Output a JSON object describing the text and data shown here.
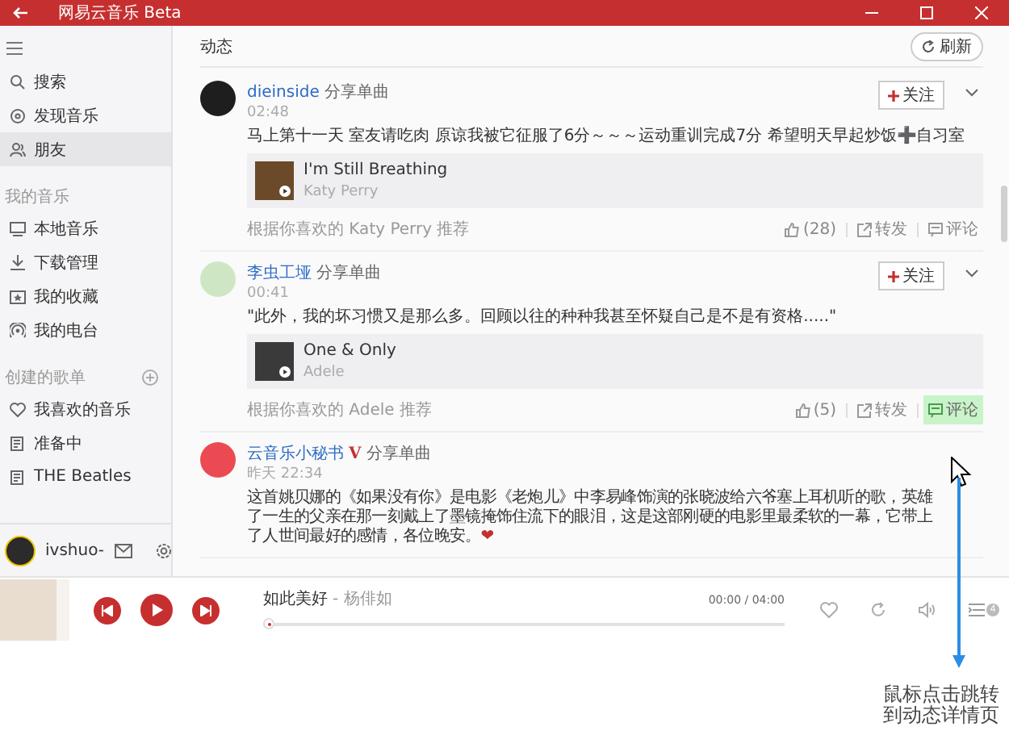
{
  "window": {
    "title": "网易云音乐 Beta"
  },
  "sidebar": {
    "nav": [
      {
        "label": "搜索",
        "selected": false
      },
      {
        "label": "发现音乐",
        "selected": false
      },
      {
        "label": "朋友",
        "selected": true
      }
    ],
    "sections": [
      {
        "title": "我的音乐",
        "items": [
          {
            "label": "本地音乐",
            "selected": false
          },
          {
            "label": "下载管理",
            "selected": false
          },
          {
            "label": "我的收藏",
            "selected": false
          },
          {
            "label": "我的电台",
            "selected": false
          }
        ]
      },
      {
        "title": "创建的歌单",
        "items": [
          {
            "label": "我喜欢的音乐",
            "selected": false
          },
          {
            "label": "准备中",
            "selected": false
          },
          {
            "label": "THE Beatles",
            "selected": false
          }
        ]
      }
    ],
    "user": {
      "name": "ivshuo-"
    }
  },
  "feed": {
    "title": "动态",
    "refresh": "刷新",
    "posts": [
      {
        "author": "dieinside",
        "action": "分享单曲",
        "time": "02:48",
        "follow": "关注",
        "text": "马上第十一天 室友请吃肉 原谅我被它征服了6分～～～运动重训完成7分 希望明天早起炒饭➕自习室",
        "song": {
          "title": "I'm Still Breathing",
          "artist": "Katy Perry"
        },
        "source": "根据你喜欢的 Katy Perry 推荐",
        "likes": "(28)",
        "share": "转发",
        "comment": "评论",
        "comment_hovered": false
      },
      {
        "author": "李虫工垭",
        "action": "分享单曲",
        "time": "00:41",
        "follow": "关注",
        "text": "\"此外，我的坏习惯又是那么多。回顾以往的种种我甚至怀疑自己是不是有资格.....\"",
        "song": {
          "title": "One & Only",
          "artist": "Adele"
        },
        "source": "根据你喜欢的 Adele 推荐",
        "likes": "(5)",
        "share": "转发",
        "comment": "评论",
        "comment_hovered": true
      },
      {
        "author": "云音乐小秘书",
        "badge": "V",
        "action": "分享单曲",
        "time": "昨天 22:34",
        "text": "这首姚贝娜的《如果没有你》是电影《老炮儿》中李易峰饰演的张晓波给六爷塞上耳机听的歌，英雄了一生的父亲在那一刻戴上了墨镜掩饰住流下的眼泪，这是这部刚硬的电影里最柔软的一幕，它带上了人世间最好的感情，各位晚安。",
        "emoji": "❤"
      }
    ]
  },
  "player": {
    "song": "如此美好",
    "artist": "- 杨俳如",
    "time": "00:00 / 04:00",
    "level": 0,
    "queue_count": "4"
  },
  "annotation": {
    "text": "鼠标点击跳转到动态详情页"
  }
}
